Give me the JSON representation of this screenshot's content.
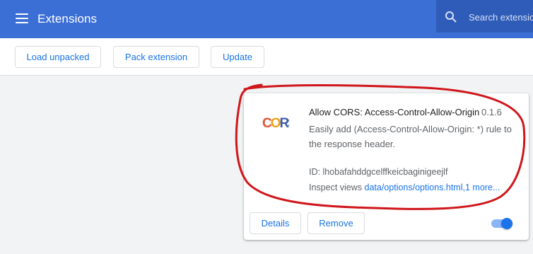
{
  "header": {
    "title": "Extensions",
    "search_placeholder": "Search extensio"
  },
  "toolbar": {
    "load_unpacked": "Load unpacked",
    "pack_extension": "Pack extension",
    "update": "Update"
  },
  "extension": {
    "name": "Allow CORS: Access-Control-Allow-Origin",
    "version": "0.1.6",
    "description": "Easily add (Access-Control-Allow-Origin: *) rule to the response header.",
    "id_text": "ID: lhobafahddgcelffkeicbaginigeejlf",
    "inspect_label": "Inspect views ",
    "inspect_link": "data/options/options.html",
    "inspect_more": "1 more...",
    "logo_text": "CORS",
    "details_label": "Details",
    "remove_label": "Remove",
    "enabled": true
  },
  "colors": {
    "header_bg": "#3b6fd6",
    "accent": "#1a73e8",
    "annotation": "#d0161b"
  }
}
